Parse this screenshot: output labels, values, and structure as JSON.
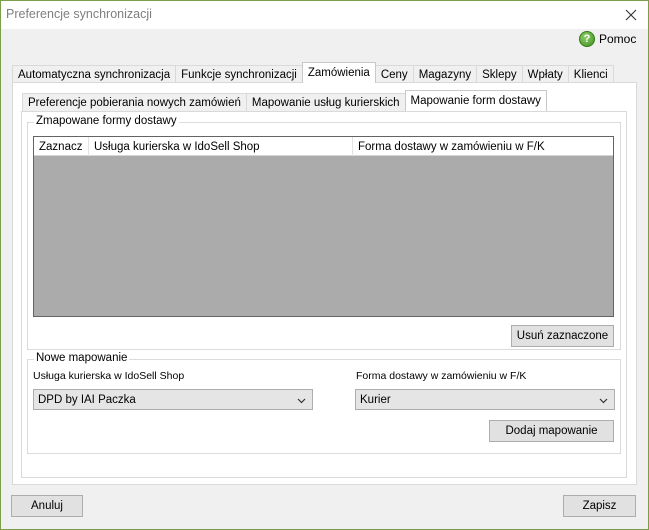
{
  "window": {
    "title": "Preferencje synchronizacji"
  },
  "help": {
    "label": "Pomoc"
  },
  "outer_tabs": [
    {
      "label": "Automatyczna synchronizacja"
    },
    {
      "label": "Funkcje synchronizacji"
    },
    {
      "label": "Zamówienia"
    },
    {
      "label": "Ceny"
    },
    {
      "label": "Magazyny"
    },
    {
      "label": "Sklepy"
    },
    {
      "label": "Wpłaty"
    },
    {
      "label": "Klienci"
    }
  ],
  "outer_tabs_active": "Zamówienia",
  "inner_tabs": [
    {
      "label": "Preferencje pobierania nowych zamówień"
    },
    {
      "label": "Mapowanie usług kurierskich"
    },
    {
      "label": "Mapowanie form dostawy"
    }
  ],
  "inner_tabs_active": "Mapowanie form dostawy",
  "mapped_group": {
    "title": "Zmapowane formy dostawy",
    "columns": [
      "Zaznacz",
      "Usługa kurierska w IdoSell Shop",
      "Forma dostawy w zamówieniu w F/K"
    ],
    "remove_button": "Usuń zaznaczone"
  },
  "new_group": {
    "title": "Nowe mapowanie",
    "service_label": "Usługa kurierska w IdoSell Shop",
    "service_value": "DPD by IAI Paczka",
    "delivery_label": "Forma dostawy w zamówieniu w F/K",
    "delivery_value": "Kurier",
    "add_button": "Dodaj mapowanie"
  },
  "footer": {
    "cancel": "Anuluj",
    "save": "Zapisz"
  },
  "colors": {
    "window_border": "#7a9e4a",
    "grid_empty": "#ababab",
    "help_icon": "#3f8f1e"
  }
}
